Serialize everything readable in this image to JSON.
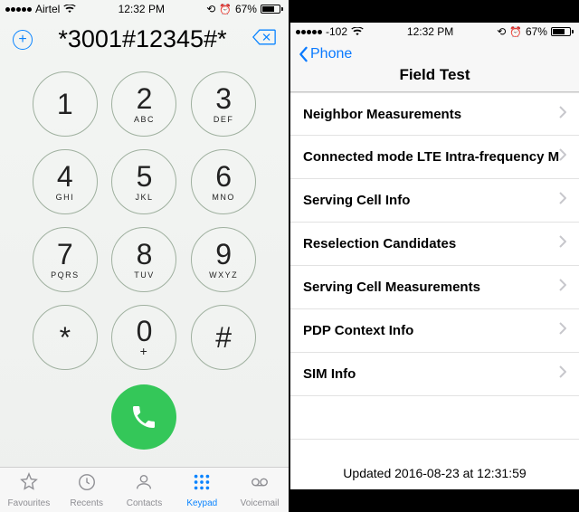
{
  "left": {
    "status": {
      "carrier": "Airtel",
      "time": "12:32 PM",
      "battery": "67%"
    },
    "entered_number": "*3001#12345#*",
    "keys": [
      {
        "digit": "1",
        "letters": ""
      },
      {
        "digit": "2",
        "letters": "ABC"
      },
      {
        "digit": "3",
        "letters": "DEF"
      },
      {
        "digit": "4",
        "letters": "GHI"
      },
      {
        "digit": "5",
        "letters": "JKL"
      },
      {
        "digit": "6",
        "letters": "MNO"
      },
      {
        "digit": "7",
        "letters": "PQRS"
      },
      {
        "digit": "8",
        "letters": "TUV"
      },
      {
        "digit": "9",
        "letters": "WXYZ"
      },
      {
        "digit": "*",
        "letters": ""
      },
      {
        "digit": "0",
        "letters": "+"
      },
      {
        "digit": "#",
        "letters": ""
      }
    ],
    "tabs": [
      {
        "id": "favourites",
        "label": "Favourites",
        "active": false
      },
      {
        "id": "recents",
        "label": "Recents",
        "active": false
      },
      {
        "id": "contacts",
        "label": "Contacts",
        "active": false
      },
      {
        "id": "keypad",
        "label": "Keypad",
        "active": true
      },
      {
        "id": "voicemail",
        "label": "Voicemail",
        "active": false
      }
    ]
  },
  "right": {
    "status": {
      "signal": "-102",
      "time": "12:32 PM",
      "battery": "67%"
    },
    "nav": {
      "back": "Phone",
      "title": "Field Test"
    },
    "items": [
      "Neighbor Measurements",
      "Connected mode LTE Intra-frequency Meas",
      "Serving Cell Info",
      "Reselection Candidates",
      "Serving Cell Measurements",
      "PDP Context Info",
      "SIM Info"
    ],
    "updated": "Updated 2016-08-23 at 12:31:59"
  }
}
